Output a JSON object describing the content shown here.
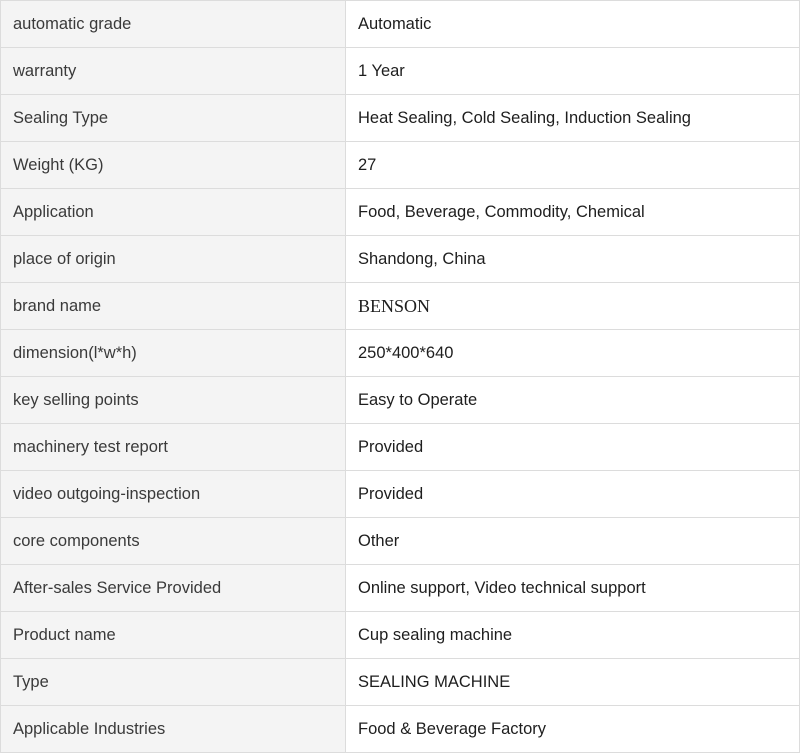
{
  "specs": [
    {
      "label": "automatic grade",
      "value": "Automatic"
    },
    {
      "label": "warranty",
      "value": "1 Year"
    },
    {
      "label": "Sealing Type",
      "value": "Heat Sealing, Cold Sealing, Induction Sealing"
    },
    {
      "label": "Weight (KG)",
      "value": "27"
    },
    {
      "label": "Application",
      "value": "Food, Beverage, Commodity, Chemical"
    },
    {
      "label": "place of origin",
      "value": "Shandong, China"
    },
    {
      "label": "brand name",
      "value": "BENSON"
    },
    {
      "label": "dimension(l*w*h)",
      "value": "250*400*640"
    },
    {
      "label": "key selling points",
      "value": "Easy to Operate"
    },
    {
      "label": "machinery test report",
      "value": "Provided"
    },
    {
      "label": "video outgoing-inspection",
      "value": "Provided"
    },
    {
      "label": "core components",
      "value": "Other"
    },
    {
      "label": "After-sales Service Provided",
      "value": "Online support, Video technical support"
    },
    {
      "label": "Product name",
      "value": "Cup sealing machine"
    },
    {
      "label": "Type",
      "value": "SEALING MACHINE"
    },
    {
      "label": "Applicable Industries",
      "value": "Food & Beverage Factory"
    }
  ]
}
